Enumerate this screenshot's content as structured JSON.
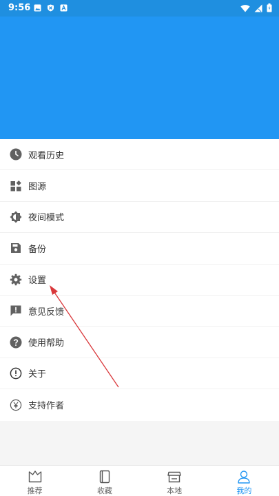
{
  "status_bar": {
    "time": "9:56"
  },
  "menu": {
    "items": [
      {
        "label": "观看历史"
      },
      {
        "label": "图源"
      },
      {
        "label": "夜间模式"
      },
      {
        "label": "备份"
      },
      {
        "label": "设置"
      },
      {
        "label": "意见反馈"
      },
      {
        "label": "使用帮助"
      },
      {
        "label": "关于"
      },
      {
        "label": "支持作者"
      }
    ]
  },
  "bottom_nav": {
    "items": [
      {
        "label": "推荐"
      },
      {
        "label": "收藏"
      },
      {
        "label": "本地"
      },
      {
        "label": "我的"
      }
    ]
  },
  "colors": {
    "header": "#2196f3",
    "statusbar": "#1f8fe0",
    "active": "#2196f3",
    "arrow": "#d9383b"
  }
}
